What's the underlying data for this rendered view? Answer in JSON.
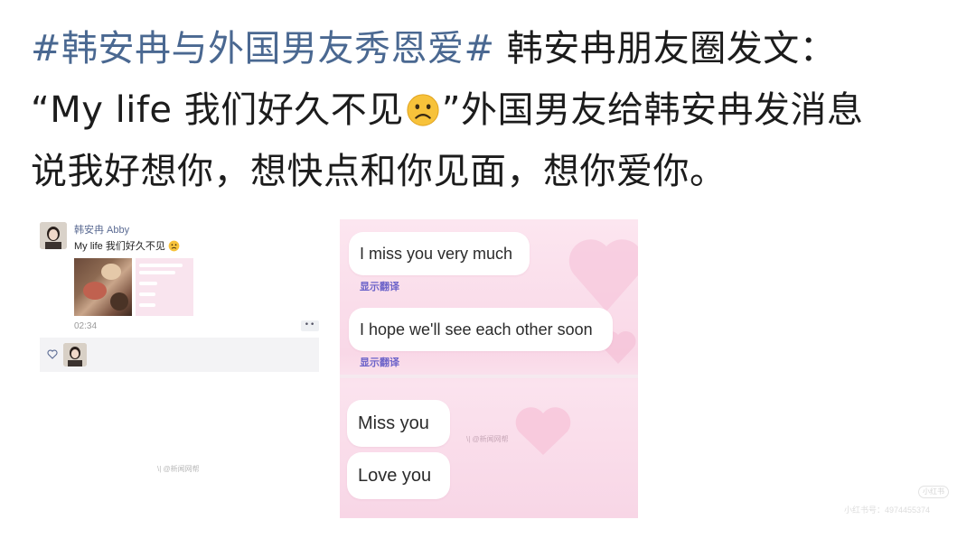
{
  "post": {
    "hashtag": "#韩安冉与外国男友秀恩爱#",
    "line1_rest": " 韩安冉朋友圈发文：",
    "line2_start": "“My life 我们好久不见",
    "line2_end": "”外国男友给韩安冉发消息",
    "line3": "说我好想你，想快点和你见面，想你爱你。",
    "emoji_icon": "frowning-face-emoji"
  },
  "moments": {
    "name": "韩安冉 Abby",
    "caption": "My life 我们好久不见",
    "time": "02:34",
    "more_label": "••",
    "watermark": "\\| @新闻网帮"
  },
  "chat": {
    "messages": [
      {
        "text": "I miss you very much",
        "translate": "显示翻译"
      },
      {
        "text": "I hope we'll see each other soon",
        "translate": "显示翻译"
      },
      {
        "text": "Miss you"
      },
      {
        "text": "Love you"
      }
    ],
    "watermark": "\\| @新闻网帮"
  },
  "footer": {
    "logo": "小红书",
    "id_text": "小红书号：4974455374"
  },
  "colors": {
    "hashtag": "#4a6891",
    "translate": "#6c63c9",
    "chat_bg": "#f9d8e7"
  }
}
